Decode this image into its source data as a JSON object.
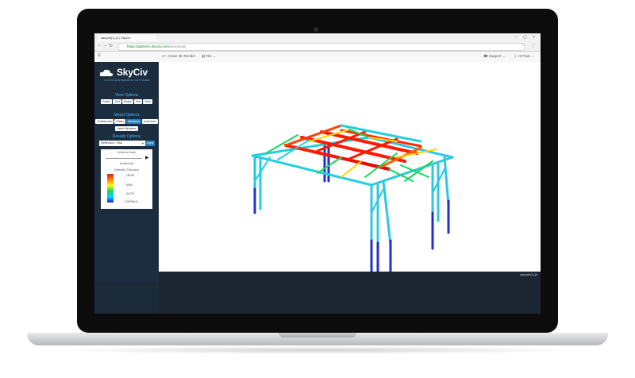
{
  "browser": {
    "tab_title": "sample(1).js | SkyCiv",
    "url_secure": "https://",
    "url_domain": "platform.skyciv.com",
    "url_path": "/structural/",
    "window_controls": "– ▢ ×"
  },
  "toolbar": {
    "close_render": "Close 3D Render",
    "file_menu": "File",
    "support_menu": "Support",
    "user_menu": "Hi Paul"
  },
  "sidebar": {
    "logo_text": "SkyCiv",
    "logo_subtitle": "CLOUD ENGINEERING SOFTWARE",
    "view_options_title": "View Options",
    "view_buttons": [
      "Frame",
      "Grid",
      "Shade",
      "Text",
      "Dark"
    ],
    "model_options_title": "Model Options",
    "model_buttons": [
      "Undeformed",
      "Plates",
      "Members",
      "Axial Axes"
    ],
    "model_button_extra": "Label Members",
    "results_options_title": "Results Options",
    "results_select": "Deflection: Total",
    "apply_label": "Apply"
  },
  "legend": {
    "scale_label": "Deflection Scale",
    "undeformed_label": "Undeformed",
    "legend_title": "Deflection: Total (mm)",
    "ticks": [
      "153.85",
      "98.95",
      "34.279",
      "0.00000e+0"
    ]
  },
  "status": {
    "file_name": "sample(1).js"
  },
  "colors": {
    "accent": "#2b7fc0",
    "sidebar_bg": "#1b2d3e",
    "section_title": "#4db3ef"
  }
}
